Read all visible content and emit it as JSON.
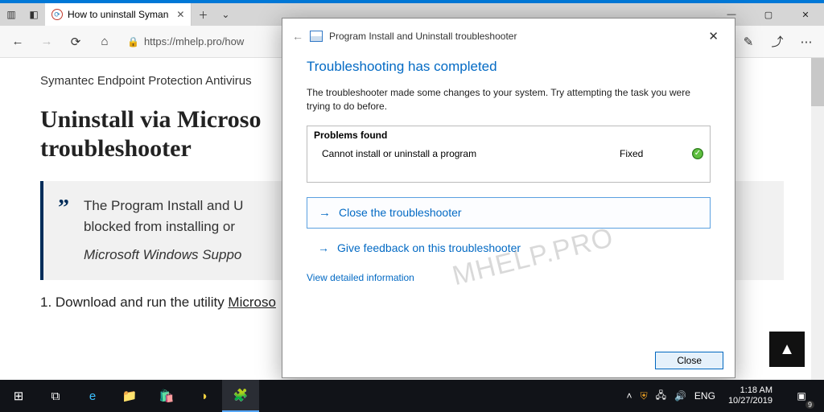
{
  "browser": {
    "tab_title": "How to uninstall Syman",
    "url": "https://mhelp.pro/how",
    "win_min": "—",
    "win_max": "▢",
    "win_close": "✕"
  },
  "page": {
    "breadcrumb": "Symantec Endpoint Protection Antivirus",
    "heading": "Uninstall via Microso troubleshooter",
    "quote_text": "The Program Install and U blocked from installing or",
    "quote_cite": "Microsoft Windows Suppo",
    "list_prefix": "1. Download and run the utility ",
    "list_link": "Microso"
  },
  "dialog": {
    "title": "Program Install and Uninstall troubleshooter",
    "heading": "Troubleshooting has completed",
    "body": "The troubleshooter made some changes to your system. Try attempting the task you were trying to do before.",
    "problems_header": "Problems found",
    "problem_name": "Cannot install or uninstall a program",
    "problem_status": "Fixed",
    "opt_close": "Close the troubleshooter",
    "opt_feedback": "Give feedback on this troubleshooter",
    "view_detail": "View detailed information",
    "close_btn": "Close"
  },
  "taskbar": {
    "lang": "ENG",
    "time": "1:18 AM",
    "date": "10/27/2019",
    "notif_count": "9"
  },
  "watermark": "MHELP.PRO"
}
